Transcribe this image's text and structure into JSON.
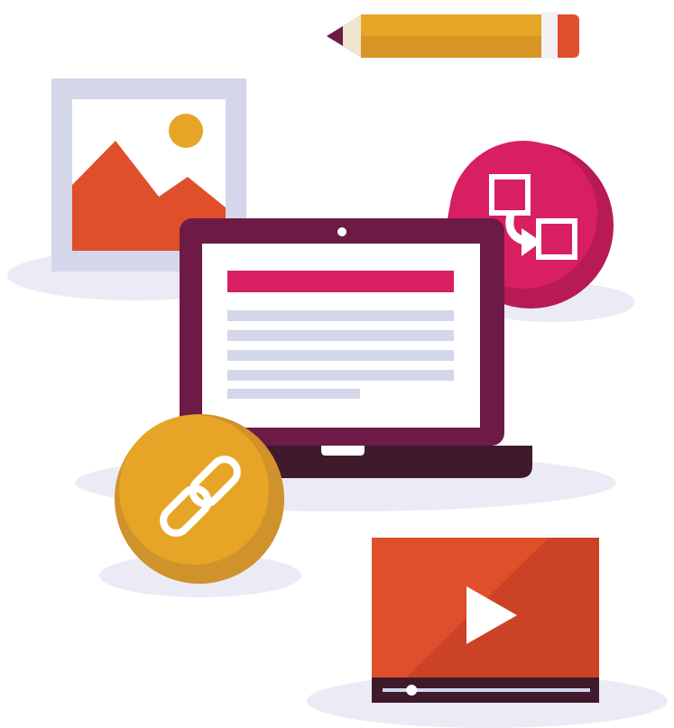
{
  "illustration": {
    "icons": [
      "pencil-icon",
      "image-icon",
      "laptop-icon",
      "convert-icon",
      "link-icon",
      "video-player-icon",
      "play-icon"
    ],
    "colors": {
      "shadow": "#EBEBF5",
      "pencil_body": "#E6A526",
      "pencil_body_shade": "#D69524",
      "pencil_band": "#F2F2F6",
      "pencil_eraser": "#E04F2B",
      "pencil_wood": "#EFE4CF",
      "pencil_lead": "#6D1A47",
      "frame": "#D4D6EA",
      "picture_bg": "#FFFFFF",
      "sun": "#E6A526",
      "mountain": "#E04F2B",
      "laptop_bezel": "#6D1A47",
      "laptop_base": "#3F1A2A",
      "laptop_screen": "#FFFFFF",
      "content_header": "#D81F62",
      "content_lines": "#D4D6EA",
      "convert_circle": "#D81F62",
      "convert_circle_shade": "#B81A55",
      "link_circle": "#E6A526",
      "link_circle_shade": "#D0922A",
      "video_bg": "#E04F2B",
      "video_shade": "#CB4226",
      "video_bar": "#3F1A2A",
      "video_track": "#D4D6EA",
      "play": "#FFFFFF"
    },
    "video_progress": 0.14
  }
}
